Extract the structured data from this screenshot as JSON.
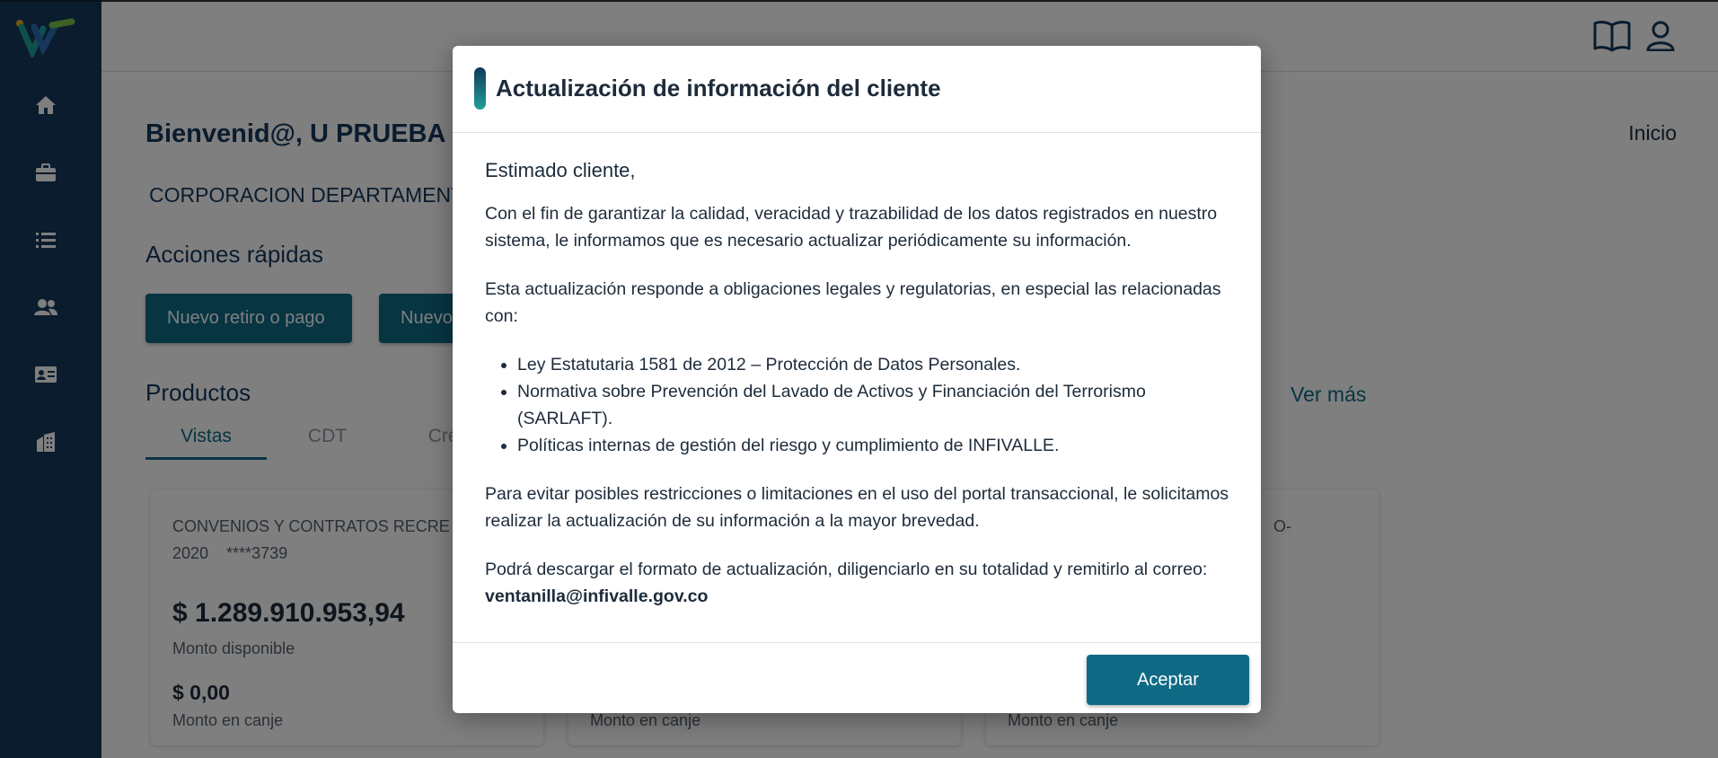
{
  "colors": {
    "sidebar": "#14385c",
    "accent": "#0e6a85",
    "title_text": "#14385c",
    "overlay": "rgba(0,0,0,0.5)"
  },
  "sidebar": {
    "logo": "infivalle-logo",
    "items": [
      {
        "icon": "home-icon"
      },
      {
        "icon": "briefcase-icon"
      },
      {
        "icon": "list-icon"
      },
      {
        "icon": "users-icon"
      },
      {
        "icon": "id-card-icon"
      },
      {
        "icon": "building-icon"
      }
    ]
  },
  "header": {
    "icons": [
      "book-icon",
      "user-icon"
    ]
  },
  "main": {
    "welcome": "Bienvenid@, U PRUEBA D",
    "breadcrumb": "Inicio",
    "entity": "CORPORACION DEPARTAMENTA",
    "quick_actions_title": "Acciones rápidas",
    "quick_actions": [
      "Nuevo retiro o pago",
      "Nuevo"
    ],
    "products_title": "Productos",
    "see_more": "Ver más",
    "tabs": [
      "Vistas",
      "CDT",
      "Créd"
    ],
    "active_tab": "Vistas",
    "cards": [
      {
        "title": "CONVENIOS Y CONTRATOS RECRE",
        "subtitle": "2020    ****3739",
        "amount": "$ 1.289.910.953,94",
        "amount_label": "Monto disponible",
        "exchange": "$ 0,00",
        "exchange_label": "Monto en canje"
      },
      {
        "exchange_label": "Monto en canje"
      },
      {
        "title_fragment": "O-",
        "exchange_label": "Monto en canje"
      }
    ]
  },
  "modal": {
    "title": "Actualización de información del cliente",
    "greeting": "Estimado cliente,",
    "paragraph1": "Con el fin de garantizar la calidad, veracidad y trazabilidad de los datos registrados en nuestro sistema, le informamos que es necesario actualizar periódicamente su información.",
    "paragraph2": "Esta actualización responde a obligaciones legales y regulatorias, en especial las relacionadas con:",
    "list": [
      "Ley Estatutaria 1581 de 2012 – Protección de Datos Personales.",
      "Normativa sobre Prevención del Lavado de Activos y Financiación del Terrorismo (SARLAFT).",
      "Políticas internas de gestión del riesgo y cumplimiento de INFIVALLE."
    ],
    "paragraph3": "Para evitar posibles restricciones o limitaciones en el uso del portal transaccional, le solicitamos realizar la actualización de su información a la mayor brevedad.",
    "paragraph4": "Podrá descargar el formato de actualización, diligenciarlo en su totalidad y remitirlo al correo:",
    "email": "ventanilla@infivalle.gov.co",
    "accept_label": "Aceptar"
  }
}
